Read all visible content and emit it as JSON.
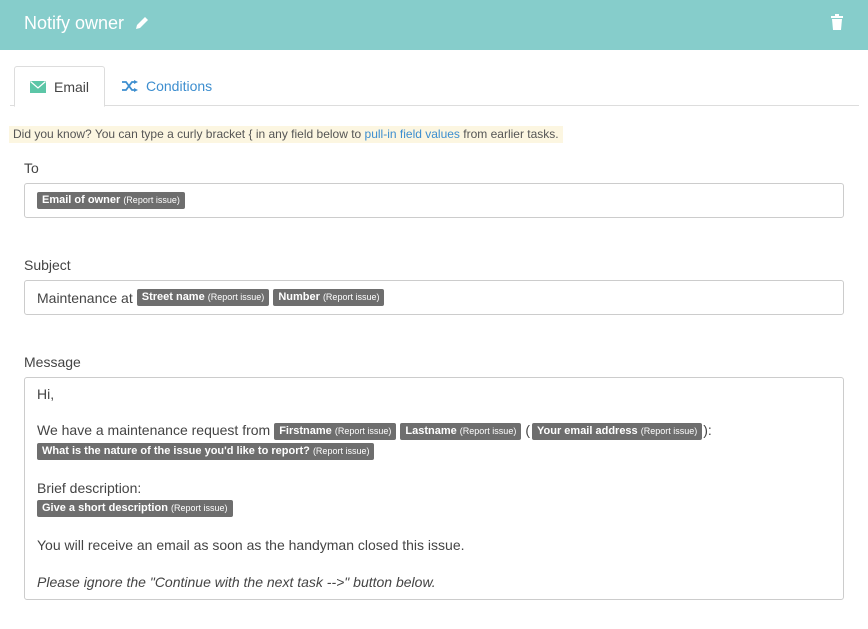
{
  "header": {
    "title": "Notify owner"
  },
  "tabs": [
    {
      "label": "Email"
    },
    {
      "label": "Conditions"
    }
  ],
  "tip": {
    "prefix": "Did you know? You can type a curly bracket { in any field below to ",
    "link": "pull-in field values",
    "suffix": " from earlier tasks."
  },
  "to": {
    "label": "To",
    "tokens": [
      {
        "name": "Email of owner",
        "src": "(Report issue)"
      }
    ]
  },
  "subject": {
    "label": "Subject",
    "prefix": "Maintenance at",
    "tokens": [
      {
        "name": "Street name",
        "src": "(Report issue)"
      },
      {
        "name": "Number",
        "src": "(Report issue)"
      }
    ]
  },
  "message": {
    "label": "Message",
    "greeting": "Hi,",
    "request_prefix": "We have a maintenance request from",
    "request_tokens": [
      {
        "name": "Firstname",
        "src": "(Report issue)"
      },
      {
        "name": "Lastname",
        "src": "(Report issue)"
      },
      {
        "name": "Your email address",
        "src": "(Report issue)"
      }
    ],
    "open_paren": "(",
    "close_paren": "):",
    "nature_token": {
      "name": "What is the nature of the issue you'd like to report?",
      "src": "(Report issue)"
    },
    "brief_label": "Brief description:",
    "brief_token": {
      "name": "Give a short description",
      "src": "(Report issue)"
    },
    "receive_line": "You will receive an email as soon as the handyman closed this issue.",
    "ignore_line": "Please ignore the \"Continue with the next task -->\" button below."
  },
  "colors": {
    "header": "#86cdcb",
    "link": "#3d8ecf",
    "token": "#6e6e6e",
    "tip_bg": "#fcf6e1"
  }
}
